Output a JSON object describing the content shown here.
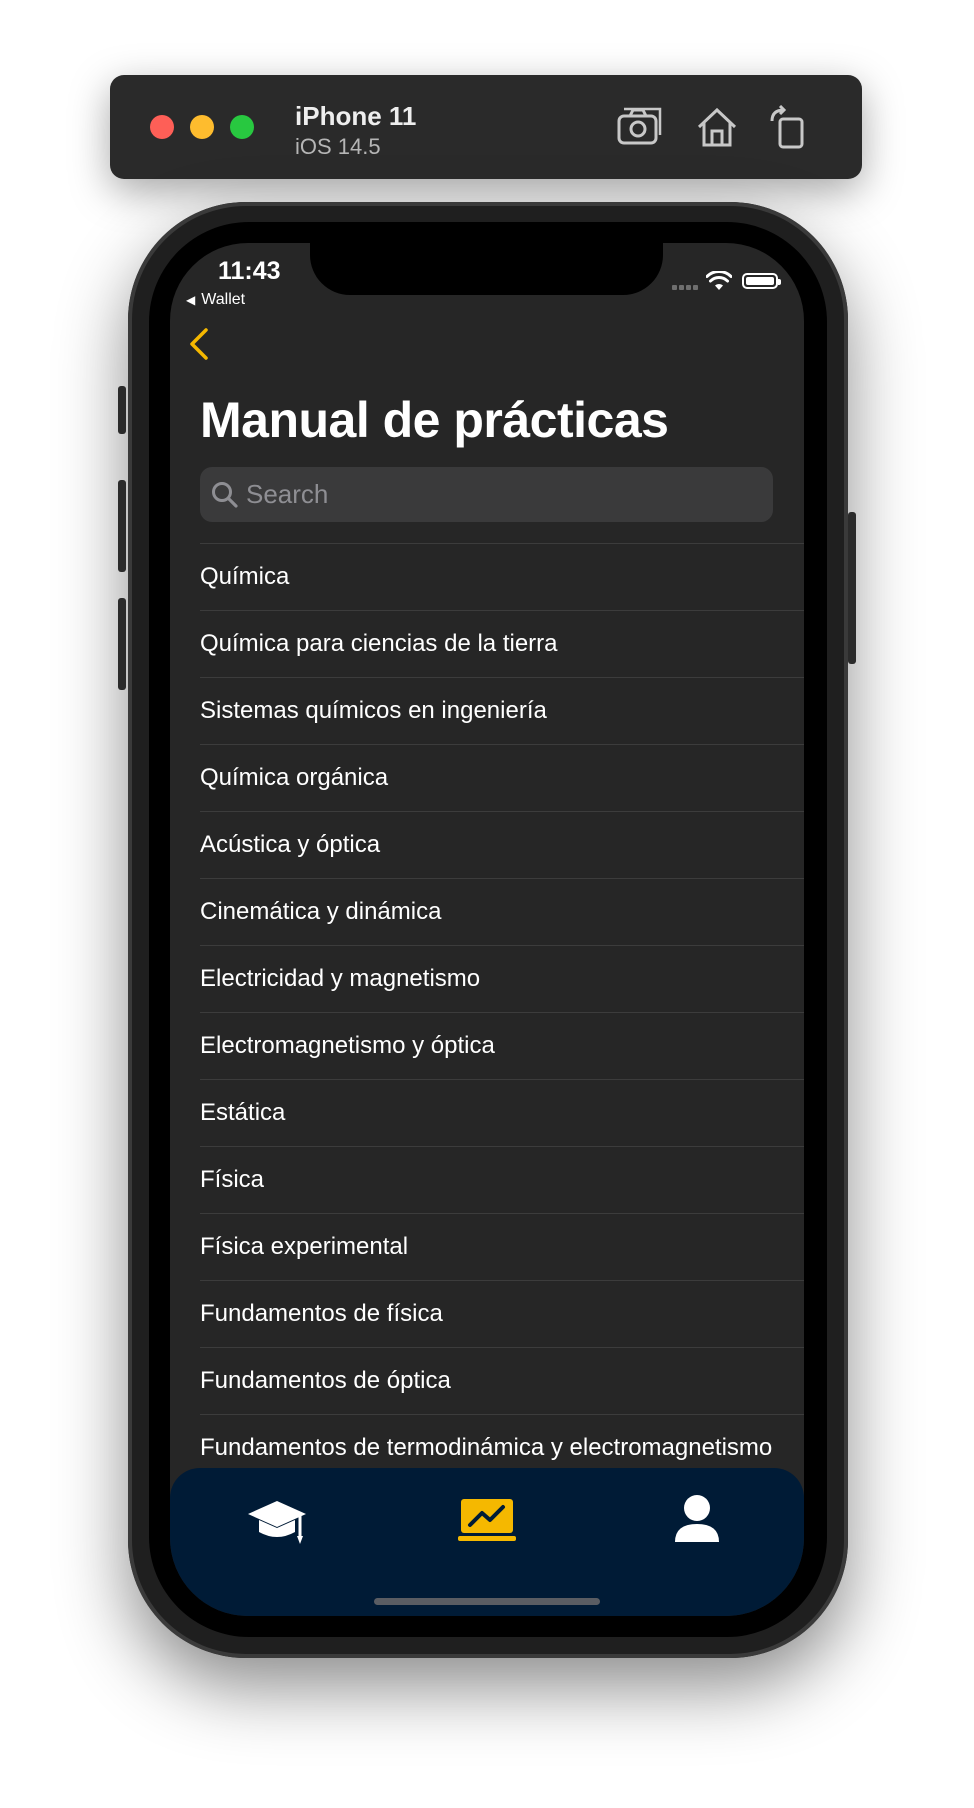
{
  "simulator": {
    "device": "iPhone 11",
    "os": "iOS 14.5",
    "icons": [
      "screenshot-icon",
      "home-icon",
      "rotate-icon"
    ]
  },
  "status_bar": {
    "time": "11:43",
    "back_app": "Wallet"
  },
  "nav": {
    "title": "Manual de prácticas"
  },
  "search": {
    "placeholder": "Search"
  },
  "subjects": [
    "Química",
    "Química para ciencias de la tierra",
    "Sistemas químicos en ingeniería",
    "Química orgánica",
    "Acústica y óptica",
    "Cinemática y dinámica",
    "Electricidad y magnetismo",
    "Electromagnetismo y óptica",
    "Estática",
    "Física",
    "Física experimental",
    "Fundamentos de física",
    "Fundamentos de óptica",
    "Fundamentos de termodinámica y electromagnetismo"
  ],
  "tab_bar": {
    "tabs": [
      {
        "icon": "graduation-cap-icon",
        "selected": false
      },
      {
        "icon": "chart-board-icon",
        "selected": true
      },
      {
        "icon": "user-icon",
        "selected": false
      }
    ]
  },
  "colors": {
    "accent": "#f5b800",
    "tab_bar_bg": "#001b36",
    "background": "#262626"
  }
}
